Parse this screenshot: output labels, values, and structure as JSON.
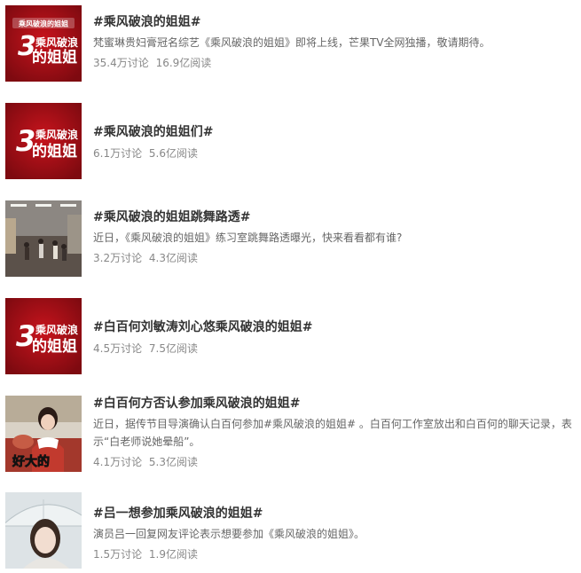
{
  "topics": [
    {
      "title": "#乘风破浪的姐姐#",
      "desc": "梵蜜琳贵妇膏冠名综艺《乘风破浪的姐姐》即将上线，芒果TV全网独播，敬请期待。",
      "discuss": "35.4万讨论",
      "reads": "16.9亿阅读",
      "thumb": "show-logo-banner"
    },
    {
      "title": "#乘风破浪的姐姐们#",
      "desc": "",
      "discuss": "6.1万讨论",
      "reads": "5.6亿阅读",
      "thumb": "show-logo"
    },
    {
      "title": "#乘风破浪的姐姐跳舞路透#",
      "desc": "近日，《乘风破浪的姐姐》练习室跳舞路透曝光，快来看看都有谁?",
      "discuss": "3.2万讨论",
      "reads": "4.3亿阅读",
      "thumb": "dance-studio-photo"
    },
    {
      "title": "#白百何刘敏涛刘心悠乘风破浪的姐姐#",
      "desc": "",
      "discuss": "4.5万讨论",
      "reads": "7.5亿阅读",
      "thumb": "show-logo"
    },
    {
      "title": "#白百何方否认参加乘风破浪的姐姐#",
      "desc": "近日，据传节目导演确认白百何参加#乘风破浪的姐姐# 。白百何工作室放出和白百何的聊天记录，表示“白老师说她晕船”。",
      "discuss": "4.1万讨论",
      "reads": "5.3亿阅读",
      "thumb": "variety-show-photo",
      "thumb_caption": "好大的"
    },
    {
      "title": "#吕一想参加乘风破浪的姐姐#",
      "desc": "演员吕一回复网友评论表示想要参加《乘风破浪的姐姐》。",
      "discuss": "1.5万讨论",
      "reads": "1.9亿阅读",
      "thumb": "portrait-photo"
    }
  ],
  "logo_text": {
    "top": "乘风破浪的",
    "bottom": "的姐姐",
    "banner": "乘风破浪的姐姐"
  },
  "colors": {
    "brand_red": "#a50f16",
    "logo_text": "#ffffff",
    "title": "#333333",
    "desc": "#666666",
    "stats": "#888888"
  }
}
